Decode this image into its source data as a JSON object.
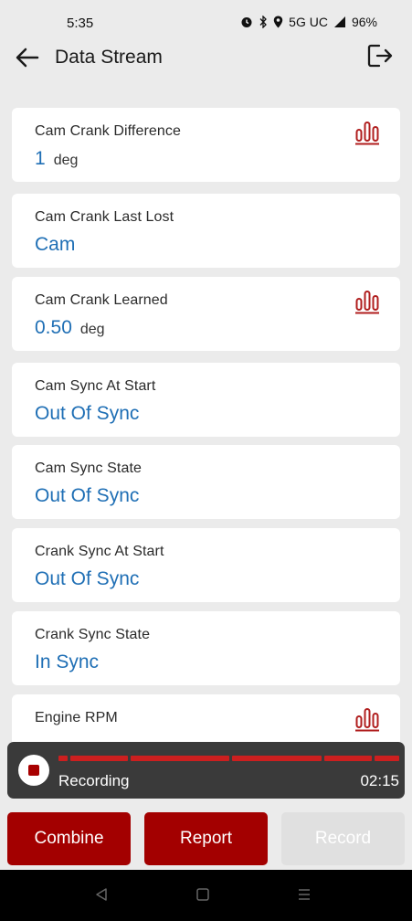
{
  "status_bar": {
    "time": "5:35",
    "network": "5G UC",
    "battery": "96%"
  },
  "app_bar": {
    "title": "Data Stream",
    "back_icon": "arrow-left-icon",
    "exit_icon": "exit-icon"
  },
  "items": [
    {
      "label": "Cam Crank Difference",
      "value": "1",
      "unit": "deg",
      "graph": true
    },
    {
      "label": "Cam Crank Last Lost",
      "value": "Cam",
      "unit": "",
      "graph": false
    },
    {
      "label": "Cam Crank Learned",
      "value": "0.50",
      "unit": "deg",
      "graph": true
    },
    {
      "label": "Cam Sync At Start",
      "value": "Out Of Sync",
      "unit": "",
      "graph": false
    },
    {
      "label": "Cam Sync State",
      "value": "Out Of Sync",
      "unit": "",
      "graph": false
    },
    {
      "label": "Crank Sync At Start",
      "value": "Out Of Sync",
      "unit": "",
      "graph": false
    },
    {
      "label": "Crank Sync State",
      "value": "In Sync",
      "unit": "",
      "graph": false
    },
    {
      "label": "Engine RPM",
      "value": "",
      "unit": "",
      "graph": true
    }
  ],
  "recording": {
    "label": "Recording",
    "time": "02:15",
    "progress": 1.0
  },
  "buttons": {
    "combine": "Combine",
    "report": "Report",
    "record": "Record"
  },
  "colors": {
    "accent": "#a30000",
    "value": "#1f6fb5",
    "graph_icon": "#b01e1e"
  }
}
